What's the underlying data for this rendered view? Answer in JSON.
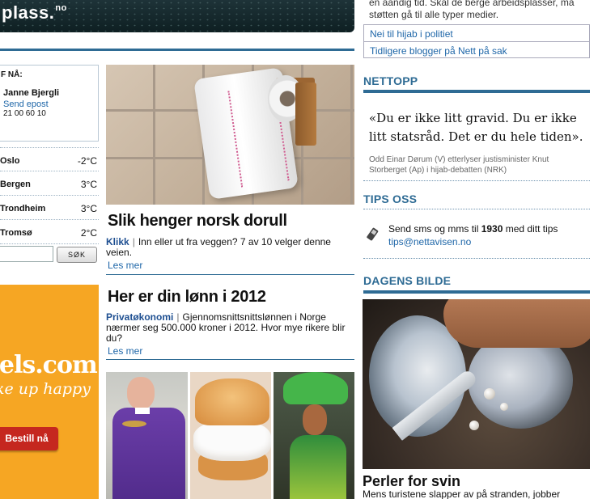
{
  "banner": {
    "logo": "plass.",
    "logo_suffix": "no"
  },
  "contact": {
    "title": "F NÅ:",
    "name": "Janne Bjergli",
    "email_link": "Send epost",
    "phone": "21 00 60 10"
  },
  "weather": [
    {
      "city": "Oslo",
      "temp": "-2°C"
    },
    {
      "city": "Bergen",
      "temp": "3°C"
    },
    {
      "city": "Trondheim",
      "temp": "3°C"
    },
    {
      "city": "Tromsø",
      "temp": "2°C"
    }
  ],
  "search": {
    "button": "SØK",
    "value": ""
  },
  "ad": {
    "logo": "tels.com",
    "tagline": "ke up happy",
    "button": "Bestill nå",
    "color": "#f6a623"
  },
  "articles": [
    {
      "title": "Slik henger norsk dorull",
      "category": "Klikk",
      "lead": "Inn eller ut fra veggen? 7 av 10 velger denne veien.",
      "more": "Les mer"
    },
    {
      "title": "Her er din lønn i 2012",
      "category": "Privatøkonomi",
      "lead": "Gjennomsnittsnittslønnen i Norge nærmer seg 500.000 kroner i 2012. Hvor mye rikere blir du?",
      "more": "Les mer"
    }
  ],
  "right": {
    "prev_text": "en aandig tid. Skal de berge arbeidsplasser, må støtten gå til alle typer medier.",
    "links": [
      "Nei til hijab i politiet",
      "Tidligere blogger på Nett på sak"
    ],
    "nettopp": {
      "title": "NETTOPP",
      "quote": "«Du er ikke litt gravid. Du er ikke litt statsråd. Det er du hele tiden».",
      "source": "Odd Einar Dørum (V) etterlyser justisminister Knut Storberget (Ap) i hijab-debatten (NRK)"
    },
    "tips": {
      "title": "TIPS OSS",
      "text_before": "Send sms og mms til ",
      "number": "1930",
      "text_after": " med ditt tips",
      "email": "tips@nettavisen.no"
    },
    "dagens_bilde": {
      "title": "DAGENS BILDE",
      "caption_title": "Perler for svin",
      "caption_text": "Mens turistene slapper av på stranden, jobber"
    }
  },
  "colors": {
    "accent": "#2e6b94",
    "link": "#1e66a8",
    "ad_button": "#c5271f"
  }
}
